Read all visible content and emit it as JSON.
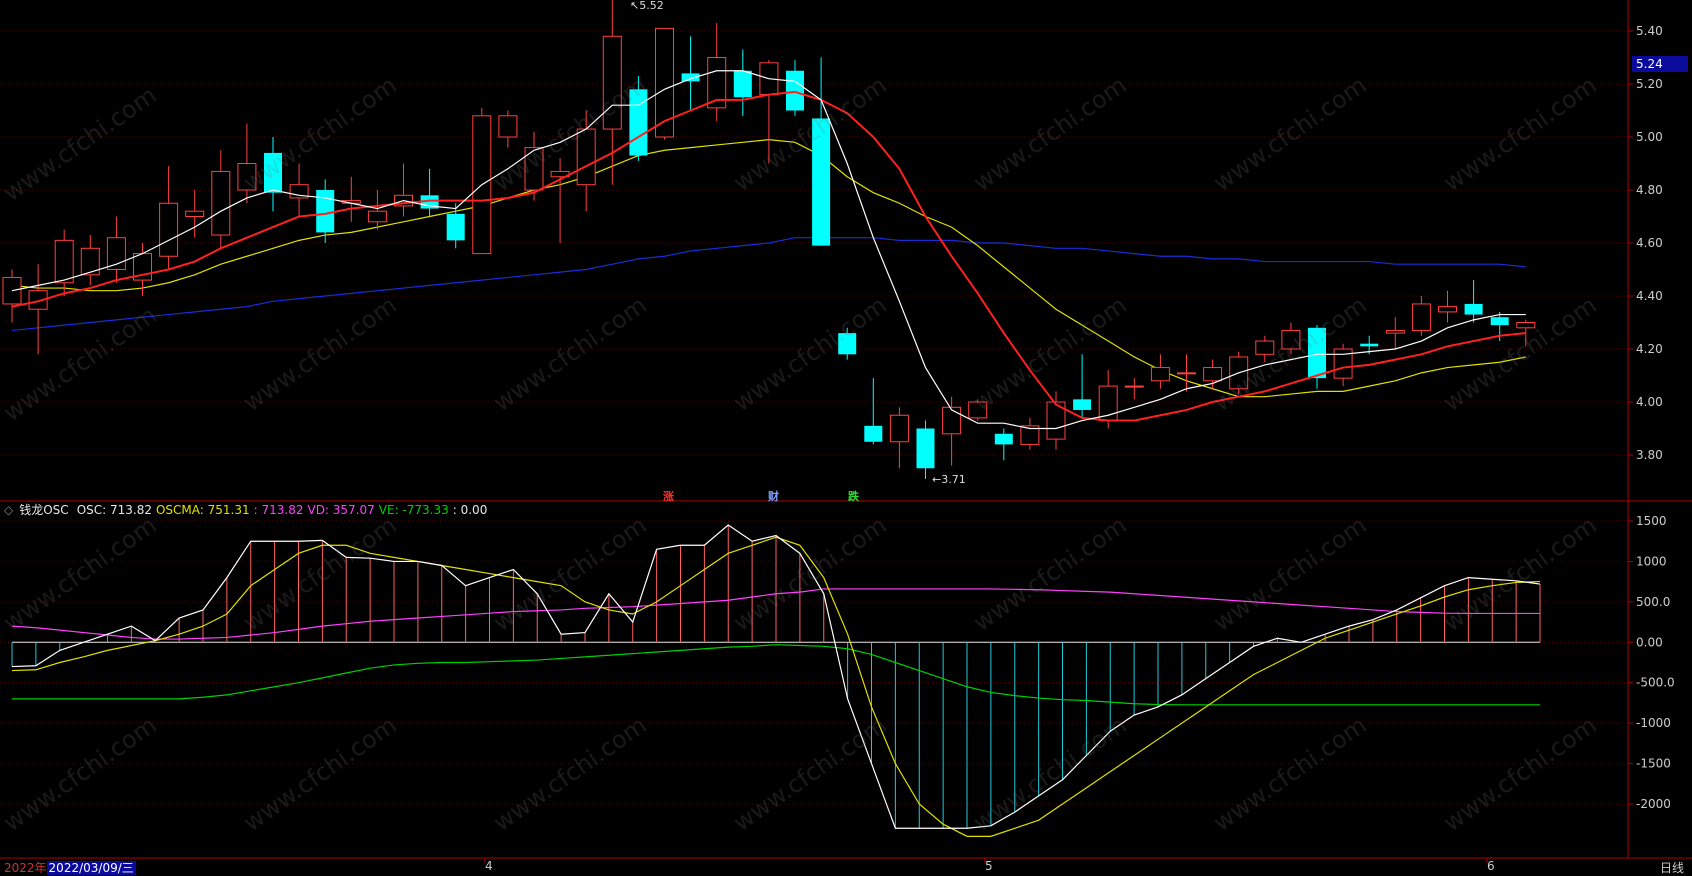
{
  "price_axis": {
    "ticks": [
      "5.40",
      "5.20",
      "5.00",
      "4.80",
      "4.60",
      "4.40",
      "4.20",
      "4.00",
      "3.80"
    ],
    "current_price": "5.24"
  },
  "annotations": {
    "high": "5.52",
    "low": "3.71"
  },
  "events": [
    {
      "label": "涨",
      "color": "#ff3030"
    },
    {
      "label": "财",
      "color": "#7fa0ff"
    },
    {
      "label": "跌",
      "color": "#30e030"
    }
  ],
  "indicator_header": {
    "icon": "◇",
    "name": "钱龙OSC",
    "osc": "OSC: 713.82",
    "oscma": "OSCMA: 751.31",
    "mid": ": 713.82",
    "vd": "VD: 357.07",
    "ve": "VE: -773.33",
    "last": ": 0.00"
  },
  "osc_axis": {
    "ticks": [
      "1500",
      "1000",
      "500.0",
      "0.00",
      "-500.0",
      "-1000",
      "-1500",
      "-2000"
    ]
  },
  "bottom": {
    "year": "2022年",
    "date": "2022/03/09/三",
    "months": [
      "4",
      "5",
      "6"
    ],
    "period": "日线"
  },
  "watermark": "www.cfchi.com",
  "colors": {
    "up": "#ff4040",
    "down": "#00ffff",
    "ma5": "#ffffff",
    "ma10": "#ff2020",
    "ma20": "#e0e000",
    "ma60": "#1a2dd6",
    "oscma": "#e0e000",
    "vd": "#ff40ff",
    "ve": "#00d000",
    "axis": "#b00000"
  },
  "chart_data": [
    {
      "type": "candlestick",
      "title": "",
      "ylim": [
        3.65,
        5.55
      ],
      "candles": [
        {
          "o": 4.37,
          "c": 4.47,
          "h": 4.5,
          "l": 4.3
        },
        {
          "o": 4.35,
          "c": 4.42,
          "h": 4.52,
          "l": 4.18
        },
        {
          "o": 4.45,
          "c": 4.61,
          "h": 4.65,
          "l": 4.4
        },
        {
          "o": 4.48,
          "c": 4.58,
          "h": 4.63,
          "l": 4.44
        },
        {
          "o": 4.5,
          "c": 4.62,
          "h": 4.7,
          "l": 4.45
        },
        {
          "o": 4.46,
          "c": 4.56,
          "h": 4.6,
          "l": 4.4
        },
        {
          "o": 4.55,
          "c": 4.75,
          "h": 4.89,
          "l": 4.5
        },
        {
          "o": 4.7,
          "c": 4.72,
          "h": 4.8,
          "l": 4.62
        },
        {
          "o": 4.63,
          "c": 4.87,
          "h": 4.95,
          "l": 4.58
        },
        {
          "o": 4.8,
          "c": 4.9,
          "h": 5.05,
          "l": 4.75
        },
        {
          "o": 4.94,
          "c": 4.79,
          "h": 5.0,
          "l": 4.72
        },
        {
          "o": 4.77,
          "c": 4.82,
          "h": 4.9,
          "l": 4.7
        },
        {
          "o": 4.8,
          "c": 4.64,
          "h": 4.84,
          "l": 4.6
        },
        {
          "o": 4.75,
          "c": 4.76,
          "h": 4.85,
          "l": 4.68
        },
        {
          "o": 4.68,
          "c": 4.72,
          "h": 4.8,
          "l": 4.65
        },
        {
          "o": 4.74,
          "c": 4.78,
          "h": 4.9,
          "l": 4.7
        },
        {
          "o": 4.78,
          "c": 4.73,
          "h": 4.88,
          "l": 4.7
        },
        {
          "o": 4.71,
          "c": 4.61,
          "h": 4.75,
          "l": 4.58
        },
        {
          "o": 4.56,
          "c": 5.08,
          "h": 5.11,
          "l": 4.56
        },
        {
          "o": 5.0,
          "c": 5.08,
          "h": 5.1,
          "l": 4.96
        },
        {
          "o": 4.8,
          "c": 4.96,
          "h": 5.02,
          "l": 4.76
        },
        {
          "o": 4.85,
          "c": 4.87,
          "h": 4.92,
          "l": 4.6
        },
        {
          "o": 4.82,
          "c": 5.03,
          "h": 5.1,
          "l": 4.72
        },
        {
          "o": 5.03,
          "c": 5.38,
          "h": 5.52,
          "l": 4.82
        },
        {
          "o": 5.18,
          "c": 4.93,
          "h": 5.23,
          "l": 4.91
        },
        {
          "o": 5.0,
          "c": 5.41,
          "h": 5.41,
          "l": 4.99
        },
        {
          "o": 5.24,
          "c": 5.21,
          "h": 5.38,
          "l": 5.1
        },
        {
          "o": 5.11,
          "c": 5.3,
          "h": 5.43,
          "l": 5.06
        },
        {
          "o": 5.25,
          "c": 5.15,
          "h": 5.33,
          "l": 5.08
        },
        {
          "o": 5.16,
          "c": 5.28,
          "h": 5.29,
          "l": 4.9
        },
        {
          "o": 5.25,
          "c": 5.1,
          "h": 5.29,
          "l": 5.08
        },
        {
          "o": 5.07,
          "c": 4.59,
          "h": 5.3,
          "l": 4.59
        },
        {
          "o": 4.26,
          "c": 4.18,
          "h": 4.28,
          "l": 4.16
        },
        {
          "o": 3.91,
          "c": 3.85,
          "h": 4.09,
          "l": 3.84
        },
        {
          "o": 3.85,
          "c": 3.95,
          "h": 3.98,
          "l": 3.75
        },
        {
          "o": 3.9,
          "c": 3.75,
          "h": 3.93,
          "l": 3.71
        },
        {
          "o": 3.88,
          "c": 3.98,
          "h": 4.02,
          "l": 3.76
        },
        {
          "o": 3.94,
          "c": 4.0,
          "h": 4.01,
          "l": 3.93
        },
        {
          "o": 3.88,
          "c": 3.84,
          "h": 3.9,
          "l": 3.78
        },
        {
          "o": 3.84,
          "c": 3.91,
          "h": 3.94,
          "l": 3.82
        },
        {
          "o": 3.86,
          "c": 4.0,
          "h": 4.04,
          "l": 3.82
        },
        {
          "o": 4.01,
          "c": 3.97,
          "h": 4.18,
          "l": 3.94
        },
        {
          "o": 3.93,
          "c": 4.06,
          "h": 4.12,
          "l": 3.9
        },
        {
          "o": 4.06,
          "c": 4.06,
          "h": 4.09,
          "l": 4.01
        },
        {
          "o": 4.08,
          "c": 4.13,
          "h": 4.18,
          "l": 4.05
        },
        {
          "o": 4.11,
          "c": 4.11,
          "h": 4.18,
          "l": 4.04
        },
        {
          "o": 4.08,
          "c": 4.13,
          "h": 4.16,
          "l": 4.05
        },
        {
          "o": 4.05,
          "c": 4.17,
          "h": 4.19,
          "l": 4.03
        },
        {
          "o": 4.18,
          "c": 4.23,
          "h": 4.25,
          "l": 4.15
        },
        {
          "o": 4.2,
          "c": 4.27,
          "h": 4.3,
          "l": 4.18
        },
        {
          "o": 4.28,
          "c": 4.09,
          "h": 4.29,
          "l": 4.05
        },
        {
          "o": 4.09,
          "c": 4.2,
          "h": 4.22,
          "l": 4.06
        },
        {
          "o": 4.22,
          "c": 4.21,
          "h": 4.25,
          "l": 4.18
        },
        {
          "o": 4.26,
          "c": 4.27,
          "h": 4.32,
          "l": 4.2
        },
        {
          "o": 4.27,
          "c": 4.37,
          "h": 4.4,
          "l": 4.25
        },
        {
          "o": 4.34,
          "c": 4.36,
          "h": 4.42,
          "l": 4.3
        },
        {
          "o": 4.37,
          "c": 4.33,
          "h": 4.46,
          "l": 4.3
        },
        {
          "o": 4.32,
          "c": 4.29,
          "h": 4.34,
          "l": 4.23
        },
        {
          "o": 4.28,
          "c": 4.3,
          "h": 4.31,
          "l": 4.21
        }
      ],
      "ma5": [
        4.42,
        4.44,
        4.46,
        4.49,
        4.52,
        4.56,
        4.61,
        4.66,
        4.72,
        4.77,
        4.8,
        4.78,
        4.77,
        4.75,
        4.73,
        4.76,
        4.74,
        4.73,
        4.82,
        4.88,
        4.95,
        4.98,
        5.03,
        5.12,
        5.12,
        5.18,
        5.22,
        5.25,
        5.25,
        5.22,
        5.21,
        5.14,
        4.9,
        4.62,
        4.38,
        4.13,
        3.97,
        3.92,
        3.92,
        3.9,
        3.9,
        3.93,
        3.95,
        3.98,
        4.01,
        4.05,
        4.07,
        4.11,
        4.14,
        4.16,
        4.18,
        4.18,
        4.19,
        4.2,
        4.23,
        4.28,
        4.31,
        4.33,
        4.33
      ],
      "ma10": [
        4.36,
        4.38,
        4.41,
        4.43,
        4.46,
        4.48,
        4.5,
        4.53,
        4.58,
        4.62,
        4.66,
        4.7,
        4.71,
        4.73,
        4.74,
        4.75,
        4.76,
        4.76,
        4.76,
        4.77,
        4.79,
        4.84,
        4.89,
        4.94,
        5.0,
        5.06,
        5.1,
        5.14,
        5.14,
        5.16,
        5.17,
        5.14,
        5.09,
        5.0,
        4.88,
        4.7,
        4.55,
        4.41,
        4.26,
        4.12,
        3.99,
        3.94,
        3.93,
        3.93,
        3.95,
        3.97,
        4.0,
        4.02,
        4.04,
        4.07,
        4.1,
        4.13,
        4.14,
        4.16,
        4.18,
        4.21,
        4.23,
        4.25,
        4.26
      ],
      "ma20": [
        4.44,
        4.43,
        4.43,
        4.42,
        4.42,
        4.43,
        4.45,
        4.48,
        4.52,
        4.55,
        4.58,
        4.61,
        4.63,
        4.64,
        4.66,
        4.68,
        4.7,
        4.72,
        4.74,
        4.77,
        4.8,
        4.82,
        4.85,
        4.89,
        4.93,
        4.95,
        4.96,
        4.97,
        4.98,
        4.99,
        4.98,
        4.93,
        4.85,
        4.79,
        4.75,
        4.7,
        4.66,
        4.59,
        4.51,
        4.43,
        4.35,
        4.29,
        4.23,
        4.17,
        4.12,
        4.08,
        4.05,
        4.02,
        4.02,
        4.03,
        4.04,
        4.04,
        4.06,
        4.08,
        4.11,
        4.13,
        4.14,
        4.15,
        4.17
      ],
      "ma60": [
        4.27,
        4.28,
        4.29,
        4.3,
        4.31,
        4.32,
        4.33,
        4.34,
        4.35,
        4.36,
        4.38,
        4.39,
        4.4,
        4.41,
        4.42,
        4.43,
        4.44,
        4.45,
        4.46,
        4.47,
        4.48,
        4.49,
        4.5,
        4.52,
        4.54,
        4.55,
        4.57,
        4.58,
        4.59,
        4.6,
        4.62,
        4.62,
        4.62,
        4.62,
        4.61,
        4.61,
        4.61,
        4.6,
        4.6,
        4.59,
        4.58,
        4.58,
        4.57,
        4.56,
        4.55,
        4.55,
        4.54,
        4.54,
        4.53,
        4.53,
        4.53,
        4.53,
        4.53,
        4.52,
        4.52,
        4.52,
        4.52,
        4.52,
        4.51
      ]
    },
    {
      "type": "line",
      "title": "钱龙OSC",
      "ylim": [
        -2600,
        1700
      ],
      "series": [
        {
          "name": "OSC",
          "values": [
            -300,
            -290,
            -100,
            0,
            100,
            200,
            20,
            300,
            400,
            800,
            1250,
            1250,
            1250,
            1260,
            1050,
            1040,
            1000,
            1000,
            950,
            700,
            800,
            900,
            600,
            100,
            120,
            600,
            250,
            1150,
            1200,
            1200,
            1450,
            1250,
            1320,
            1100,
            600,
            -700,
            -1500,
            -2300,
            -2300,
            -2300,
            -2300,
            -2270,
            -2100,
            -1900,
            -1700,
            -1400,
            -1100,
            -900,
            -800,
            -650,
            -450,
            -250,
            -50,
            50,
            0,
            100,
            200,
            280,
            400,
            550,
            700,
            800,
            780,
            760,
            720
          ]
        },
        {
          "name": "OSCMA",
          "values": [
            -350,
            -340,
            -250,
            -180,
            -100,
            -40,
            20,
            100,
            200,
            350,
            700,
            900,
            1100,
            1200,
            1200,
            1100,
            1050,
            1000,
            950,
            900,
            850,
            800,
            750,
            700,
            500,
            400,
            350,
            500,
            700,
            900,
            1100,
            1200,
            1300,
            1200,
            800,
            100,
            -800,
            -1500,
            -2000,
            -2250,
            -2400,
            -2400,
            -2300,
            -2200,
            -2000,
            -1800,
            -1600,
            -1400,
            -1200,
            -1000,
            -800,
            -600,
            -400,
            -250,
            -100,
            50,
            150,
            250,
            350,
            450,
            560,
            650,
            700,
            740,
            751
          ]
        },
        {
          "name": "VD",
          "values": [
            200,
            180,
            150,
            120,
            90,
            60,
            40,
            40,
            50,
            60,
            90,
            120,
            160,
            200,
            230,
            260,
            280,
            300,
            320,
            340,
            360,
            380,
            390,
            400,
            420,
            430,
            440,
            460,
            480,
            500,
            520,
            560,
            600,
            620,
            660,
            660,
            660,
            660,
            660,
            660,
            660,
            660,
            655,
            650,
            640,
            630,
            620,
            600,
            580,
            560,
            540,
            520,
            500,
            480,
            460,
            440,
            420,
            400,
            380,
            370,
            360,
            357,
            357,
            357,
            357
          ]
        },
        {
          "name": "VE",
          "values": [
            -700,
            -700,
            -700,
            -700,
            -700,
            -700,
            -700,
            -700,
            -680,
            -650,
            -600,
            -550,
            -500,
            -440,
            -380,
            -320,
            -280,
            -260,
            -250,
            -250,
            -240,
            -230,
            -220,
            -200,
            -180,
            -160,
            -140,
            -120,
            -100,
            -80,
            -60,
            -50,
            -30,
            -40,
            -50,
            -80,
            -150,
            -250,
            -350,
            -450,
            -550,
            -620,
            -660,
            -690,
            -710,
            -720,
            -740,
            -760,
            -770,
            -773,
            -773,
            -773,
            -773,
            -773,
            -773,
            -773,
            -773,
            -773,
            -773,
            -773,
            -773,
            -773,
            -773,
            -773,
            -773
          ]
        }
      ]
    }
  ]
}
